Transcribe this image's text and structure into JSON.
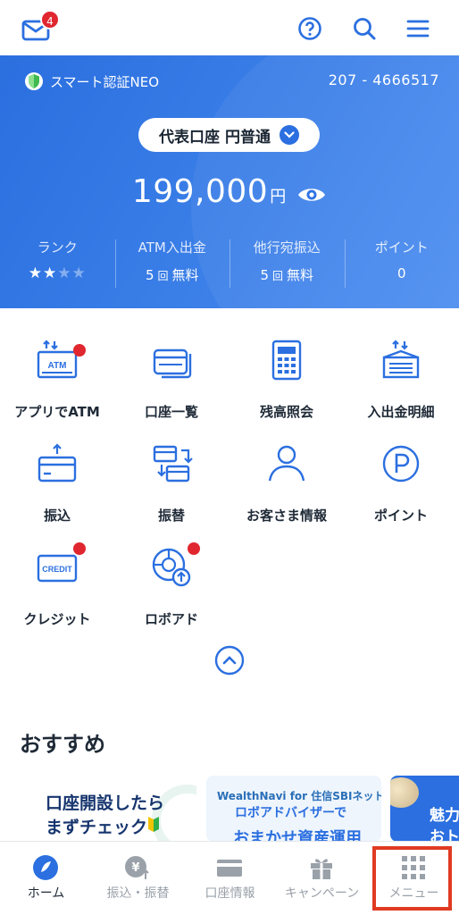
{
  "header": {
    "mail_badge": "4",
    "icons": [
      "mail-icon",
      "help-icon",
      "search-icon",
      "hamburger-menu-icon"
    ]
  },
  "card": {
    "smart_auth": "スマート認証NEO",
    "account_number": "207 - 4666517",
    "account_selector": "代表口座 円普通",
    "balance": "199,000",
    "currency": "円",
    "stats": [
      {
        "label": "ランク",
        "stars_filled": 2,
        "stars_total": 4
      },
      {
        "label": "ATM入出金",
        "count": "5",
        "unit": "回",
        "value": "無料"
      },
      {
        "label": "他行宛振込",
        "count": "5",
        "unit": "回",
        "value": "無料"
      },
      {
        "label": "ポイント",
        "value": "0"
      }
    ],
    "colors": {
      "brand_blue": "#2b6fe0",
      "badge_red": "#e0262f"
    }
  },
  "menu": {
    "items": [
      {
        "label": "アプリでATM",
        "icon": "atm-icon",
        "has_dot": true
      },
      {
        "label": "口座一覧",
        "icon": "cards-icon",
        "has_dot": false
      },
      {
        "label": "残高照会",
        "icon": "calculator-icon",
        "has_dot": false
      },
      {
        "label": "入出金明細",
        "icon": "statement-icon",
        "has_dot": false
      },
      {
        "label": "振込",
        "icon": "transfer-card-icon",
        "has_dot": false
      },
      {
        "label": "振替",
        "icon": "swap-icon",
        "has_dot": false
      },
      {
        "label": "お客さま情報",
        "icon": "person-icon",
        "has_dot": false
      },
      {
        "label": "ポイント",
        "icon": "point-p-icon",
        "has_dot": false
      },
      {
        "label": "クレジット",
        "icon": "credit-card-icon",
        "has_dot": true
      },
      {
        "label": "ロボアド",
        "icon": "robo-advisor-icon",
        "has_dot": true
      }
    ],
    "credit_card_text": "CREDIT",
    "atm_text": "ATM"
  },
  "recommend": {
    "title": "おすすめ",
    "banners": [
      {
        "line1": "口座開設したら",
        "line2": "まずチェック"
      },
      {
        "line1": "WealthNavi for 住信SBIネット銀行",
        "line2": "ロボアドバイザーで",
        "line3": "おまかせ資産運用"
      },
      {
        "line1": "魅力",
        "line2": "おトク"
      }
    ]
  },
  "bottom_nav": {
    "items": [
      {
        "label": "ホーム",
        "icon": "home-icon",
        "active": true
      },
      {
        "label": "振込・振替",
        "icon": "yen-transfer-icon",
        "active": false
      },
      {
        "label": "口座情報",
        "icon": "account-card-icon",
        "active": false
      },
      {
        "label": "キャンペーン",
        "icon": "gift-icon",
        "active": false
      },
      {
        "label": "メニュー",
        "icon": "grid-menu-icon",
        "active": false
      }
    ]
  }
}
